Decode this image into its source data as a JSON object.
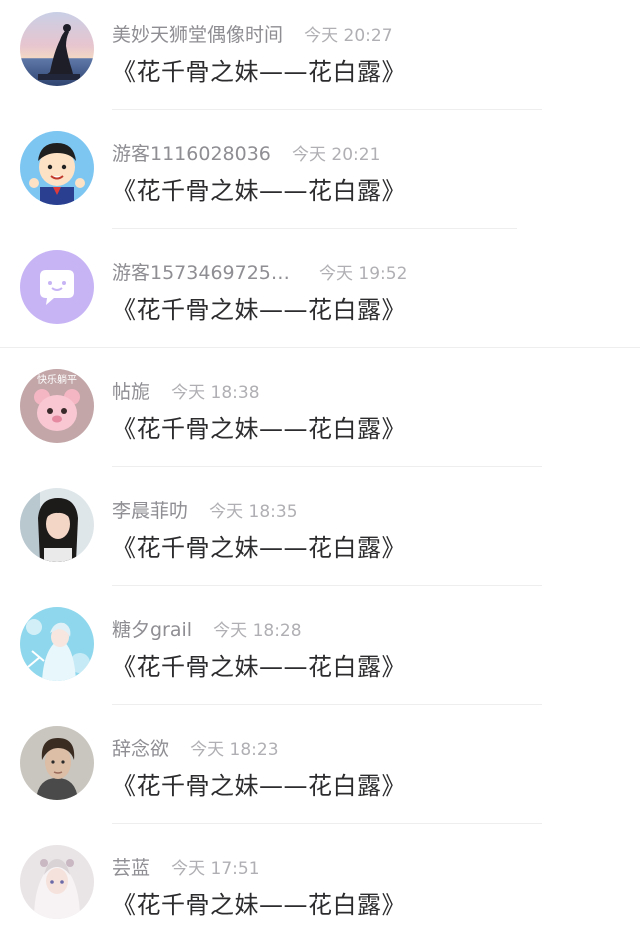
{
  "comments": [
    {
      "name": "美妙天狮堂偶像时间",
      "time": "今天 20:27",
      "text": "《花千骨之妹——花白露》",
      "avatar_icon": "avatar-sunset-yoga"
    },
    {
      "name": "游客1116028036",
      "time": "今天 20:21",
      "text": "《花千骨之妹——花白露》",
      "avatar_icon": "avatar-cartoon-boy"
    },
    {
      "name": "游客1573469725…",
      "time": "今天 19:52",
      "text": "《花千骨之妹——花白露》",
      "avatar_icon": "avatar-chat-bubble"
    },
    {
      "name": "帖旎",
      "time": "今天 18:38",
      "text": "《花千骨之妹——花白露》",
      "avatar_icon": "avatar-pink-bear"
    },
    {
      "name": "李晨菲叻",
      "time": "今天 18:35",
      "text": "《花千骨之妹——花白露》",
      "avatar_icon": "avatar-girl-photo"
    },
    {
      "name": "糖夕grail",
      "time": "今天 18:28",
      "text": "《花千骨之妹——花白露》",
      "avatar_icon": "avatar-anime-blue"
    },
    {
      "name": "辞念欲",
      "time": "今天 18:23",
      "text": "《花千骨之妹——花白露》",
      "avatar_icon": "avatar-man-portrait"
    },
    {
      "name": "芸蓝",
      "time": "今天 17:51",
      "text": "《花千骨之妹——花白露》",
      "avatar_icon": "avatar-anime-white"
    }
  ],
  "avatar_texts": {
    "bear_caption": "快乐躺平"
  },
  "colors": {
    "name": "#8e8e93",
    "time": "#b0b0b4",
    "message": "#2c2c2e",
    "divider": "#eeeeef",
    "chat_bubble_bg": "#c7b4f5"
  }
}
